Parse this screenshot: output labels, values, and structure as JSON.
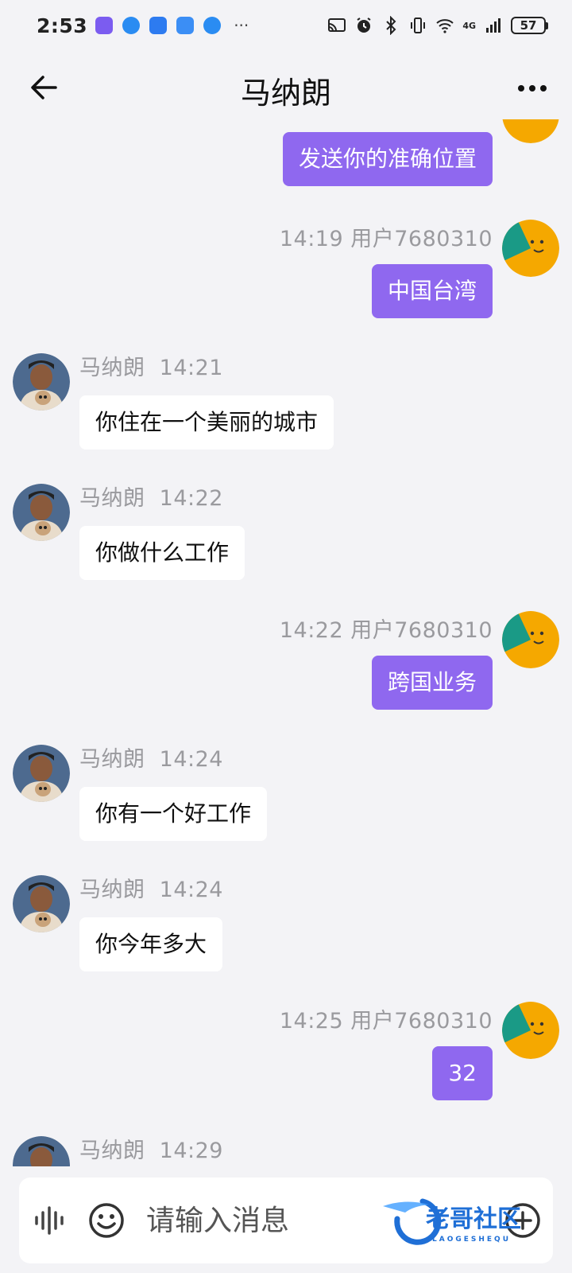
{
  "status_bar": {
    "time": "2:53",
    "network": "4G",
    "battery": "57"
  },
  "header": {
    "title": "马纳朗"
  },
  "messages": [
    {
      "from": "me",
      "text": "发送你的准确位置"
    },
    {
      "from": "me",
      "time": "14:19",
      "sender": "用户7680310",
      "text": "中国台湾"
    },
    {
      "from": "them",
      "sender": "马纳朗",
      "time": "14:21",
      "text": "你住在一个美丽的城市"
    },
    {
      "from": "them",
      "sender": "马纳朗",
      "time": "14:22",
      "text": "你做什么工作"
    },
    {
      "from": "me",
      "time": "14:22",
      "sender": "用户7680310",
      "text": "跨国业务"
    },
    {
      "from": "them",
      "sender": "马纳朗",
      "time": "14:24",
      "text": "你有一个好工作"
    },
    {
      "from": "them",
      "sender": "马纳朗",
      "time": "14:24",
      "text": "你今年多大"
    },
    {
      "from": "me",
      "time": "14:25",
      "sender": "用户7680310",
      "text": "32"
    },
    {
      "from": "them",
      "sender": "马纳朗",
      "time": "14:29",
      "text": ""
    }
  ],
  "input": {
    "placeholder": "请输入消息"
  },
  "watermark": {
    "title": "老哥社区",
    "subtitle": "LAOGESHEQU"
  },
  "colors": {
    "outgoing_bubble": "#8f68ef",
    "incoming_bubble": "#ffffff",
    "background": "#f3f3f6",
    "my_avatar": "#f5a800"
  },
  "icons": [
    "back-arrow-icon",
    "more-icon",
    "voice-icon",
    "emoji-icon",
    "plus-icon",
    "cast-icon",
    "alarm-icon",
    "bluetooth-icon",
    "vibrate-icon",
    "wifi-icon",
    "signal-icon"
  ]
}
